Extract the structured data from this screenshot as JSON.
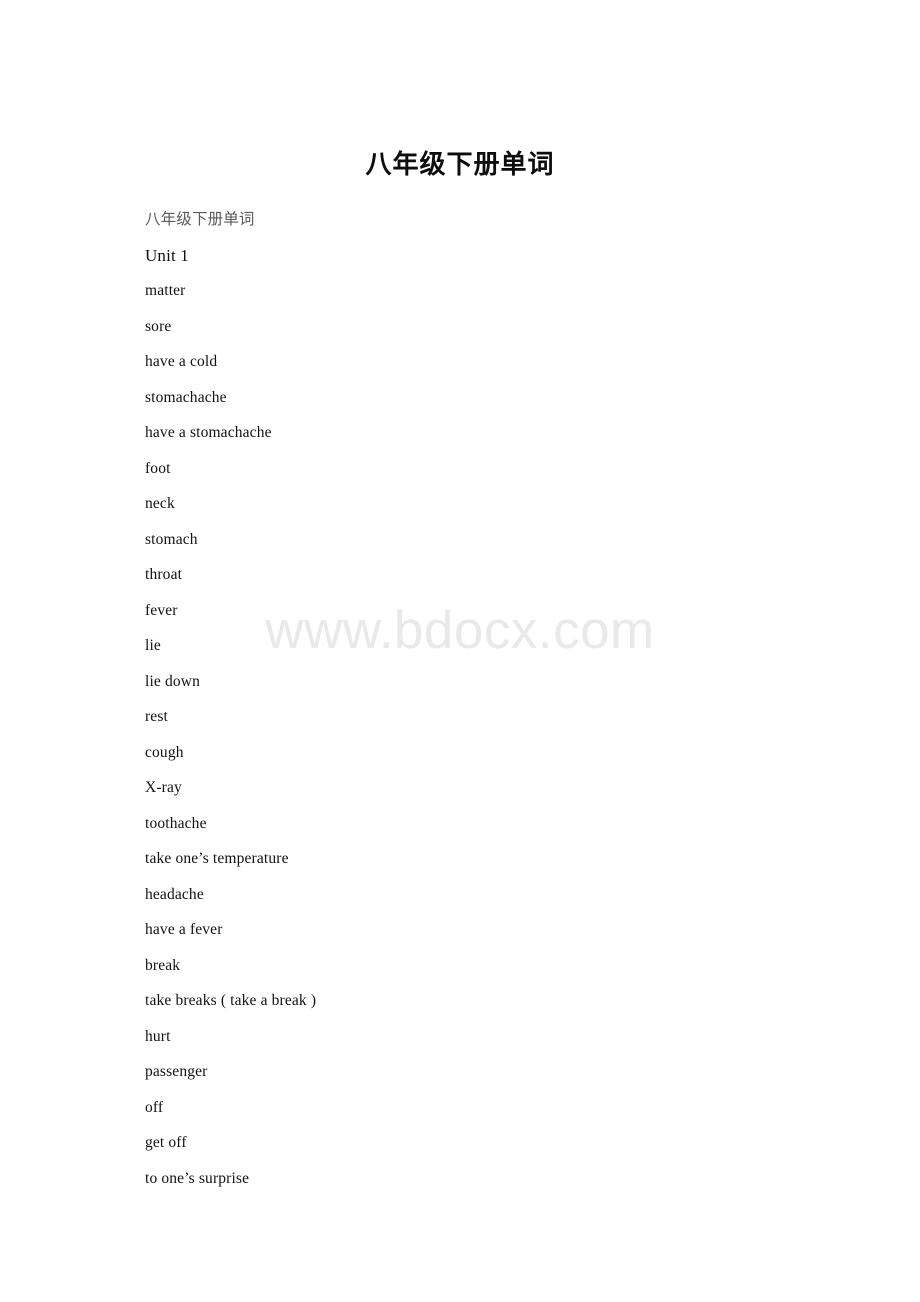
{
  "document": {
    "title": "八年级下册单词",
    "watermark": "www.bdocx.com",
    "lines": [
      {
        "text": "八年级下册单词",
        "style": "muted"
      },
      {
        "text": "Unit 1",
        "style": "heading"
      },
      {
        "text": "matter",
        "style": "normal"
      },
      {
        "text": "sore",
        "style": "normal"
      },
      {
        "text": "have a cold",
        "style": "normal"
      },
      {
        "text": "stomachache",
        "style": "normal"
      },
      {
        "text": "have a stomachache",
        "style": "normal"
      },
      {
        "text": "foot",
        "style": "normal"
      },
      {
        "text": "neck",
        "style": "normal"
      },
      {
        "text": "stomach",
        "style": "normal"
      },
      {
        "text": "throat",
        "style": "normal"
      },
      {
        "text": "fever",
        "style": "normal"
      },
      {
        "text": "lie",
        "style": "normal"
      },
      {
        "text": "lie down",
        "style": "normal"
      },
      {
        "text": "rest",
        "style": "normal"
      },
      {
        "text": "cough",
        "style": "normal"
      },
      {
        "text": "X-ray",
        "style": "normal"
      },
      {
        "text": "toothache",
        "style": "normal"
      },
      {
        "text": "take one’s temperature",
        "style": "normal"
      },
      {
        "text": "headache",
        "style": "normal"
      },
      {
        "text": "have a fever",
        "style": "normal"
      },
      {
        "text": "break",
        "style": "normal"
      },
      {
        "text": "take breaks ( take a break )",
        "style": "normal"
      },
      {
        "text": "hurt",
        "style": "normal"
      },
      {
        "text": "passenger",
        "style": "normal"
      },
      {
        "text": "off",
        "style": "normal"
      },
      {
        "text": "get off",
        "style": "normal"
      },
      {
        "text": "to one’s surprise",
        "style": "normal"
      }
    ]
  },
  "colors": {
    "page_background": "#ffffff",
    "body_text": "#121212",
    "muted_text": "#5b5b5b",
    "watermark": "#e9e9e9"
  }
}
